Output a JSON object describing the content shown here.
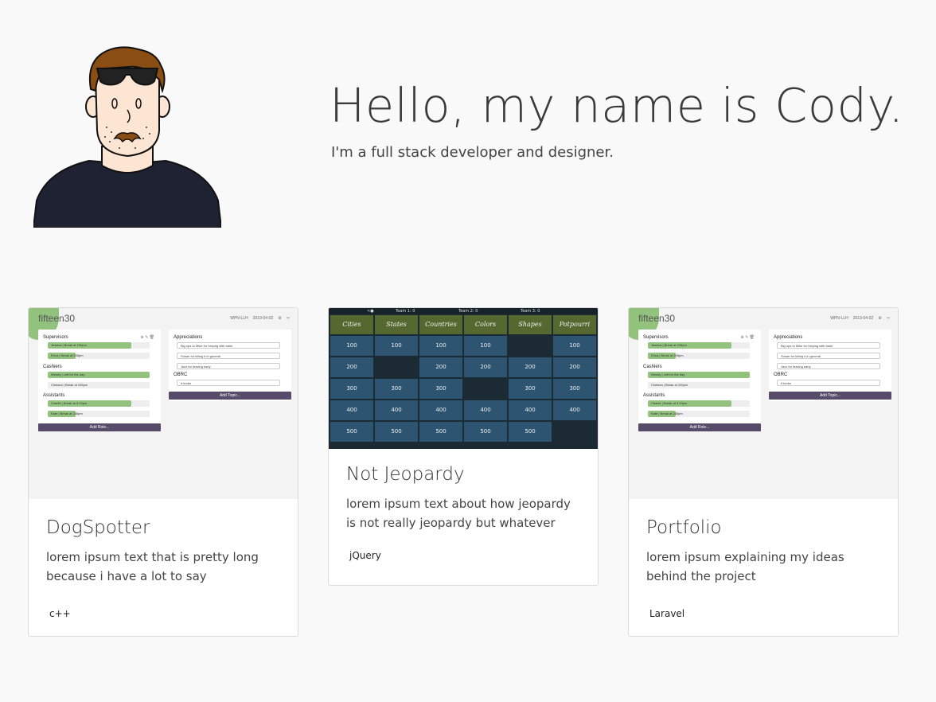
{
  "hero": {
    "title": "Hello, my name is Cody.",
    "subtitle": "I'm a full stack developer and designer."
  },
  "colors": {
    "background": "#f9f9f9",
    "accent_green": "#93c27f",
    "accent_purple": "#574b6a",
    "jeopardy_blue": "#2d5571",
    "jeopardy_olive": "#54682f",
    "jeopardy_dark": "#1b2a33"
  },
  "projects": [
    {
      "title": "DogSpotter",
      "description": "lorem ipsum text that is pretty long because i have a lot to say",
      "tag": "c++"
    },
    {
      "title": "Not Jeopardy",
      "description": "lorem ipsum text about how jeopardy is not really jeopardy but whatever",
      "tag": "jQuery"
    },
    {
      "title": "Portfolio",
      "description": "lorem ipsum explaining my ideas behind the project",
      "tag": "Laravel"
    }
  ],
  "fifteen30": {
    "brand": "fifteen30",
    "meta_1": "WPN-LLH",
    "meta_2": "2019-04-02",
    "supervisors": "Supervisors",
    "sup_1": "Jessica | Break at 230pm",
    "sup_2": "Erica | Break at 245pm",
    "cashiers": "Cashiers",
    "cash_1": "Wendy | Left for the day",
    "cash_2": "Chelsea | Break at 245pm",
    "assistants": "Assistants",
    "asst_1": "Charlie | Break at 3:15pm",
    "asst_2": "Kate | Break at 245pm",
    "add_role": "Add Role...",
    "appreciations": "Appreciations",
    "appr_1": "Big ups to Mike for helping with trash",
    "appr_2": "Susan for killing it in general",
    "appr_3": "Jazz for leaving early",
    "obrc": "OBRC",
    "obrc_1": "it broke",
    "add_topic": "Add Topic..."
  },
  "jeopardy": {
    "team_1": "Team 1: 0",
    "team_2": "Team 2: 0",
    "team_3": "Team 3: 0",
    "categories": [
      "Cities",
      "States",
      "Countries",
      "Colors",
      "Shapes",
      "Potpourri"
    ],
    "rows": [
      [
        "100",
        "100",
        "100",
        "100",
        "",
        "100"
      ],
      [
        "200",
        "",
        "200",
        "200",
        "200",
        "200"
      ],
      [
        "300",
        "300",
        "300",
        "",
        "300",
        "300"
      ],
      [
        "400",
        "400",
        "400",
        "400",
        "400",
        "400"
      ],
      [
        "500",
        "500",
        "500",
        "500",
        "500",
        ""
      ]
    ]
  }
}
